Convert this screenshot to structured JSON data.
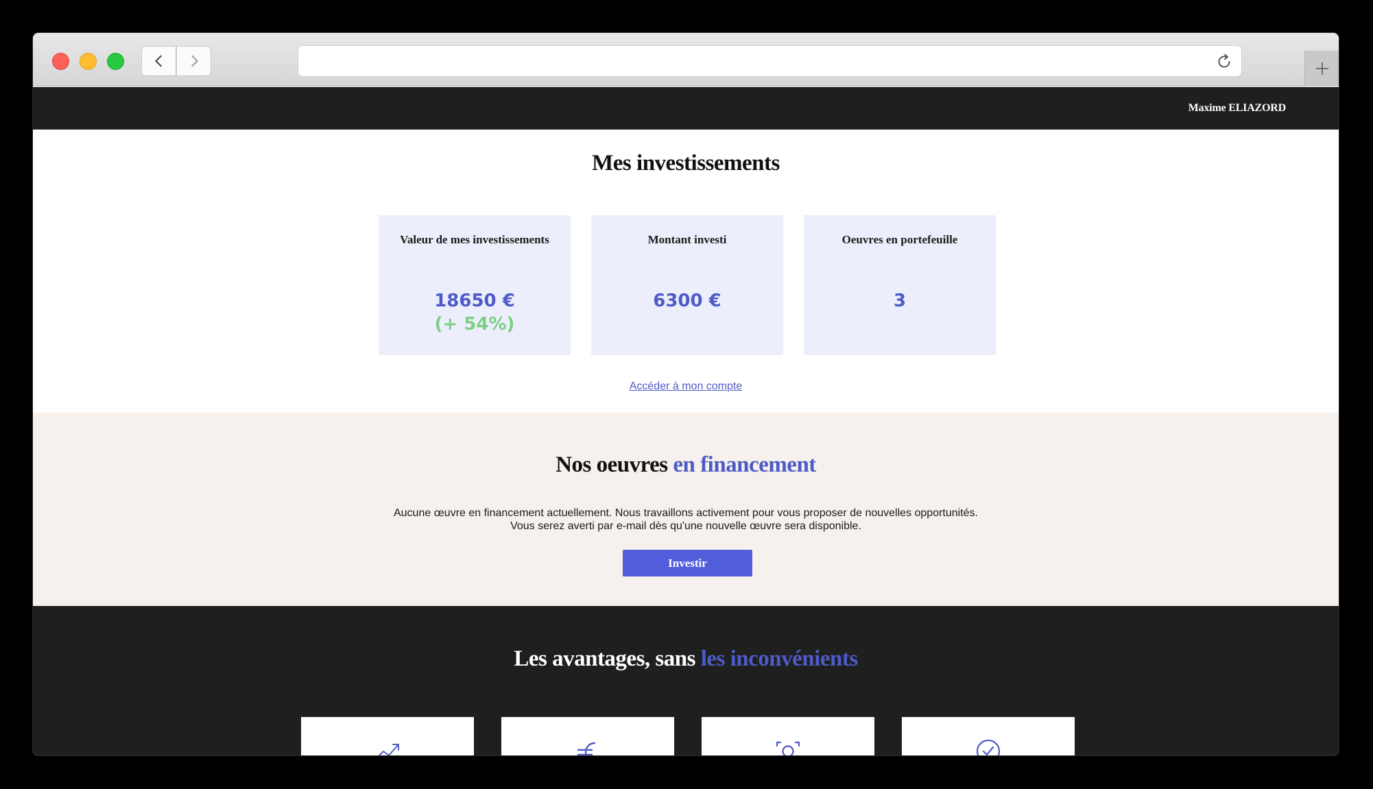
{
  "browser": {
    "url": "",
    "icons": [
      "back-icon",
      "forward-icon",
      "reload-icon",
      "plus-icon"
    ]
  },
  "header": {
    "user_name": "Maxime ELIAZORD"
  },
  "investments": {
    "title": "Mes investissements",
    "cards": [
      {
        "label": "Valeur de mes investissements",
        "value": "18650 €",
        "change": "(+ 54%)"
      },
      {
        "label": "Montant investi",
        "value": "6300 €"
      },
      {
        "label": "Oeuvres en portefeuille",
        "value": "3"
      }
    ],
    "account_link": "Accéder à mon compte"
  },
  "funding": {
    "title_main": "Nos oeuvres",
    "title_accent": "en financement",
    "text_line1": "Aucune œuvre en financement actuellement. Nous travaillons activement pour vous proposer de nouvelles opportunités.",
    "text_line2": "Vous serez averti par e-mail dès qu'une nouvelle œuvre sera disponible.",
    "button_label": "Investir"
  },
  "advantages": {
    "title_main": "Les avantages, sans",
    "title_accent": "les inconvénients",
    "icons": [
      "trend-up-icon",
      "euro-icon",
      "camera-icon",
      "check-circle-icon"
    ]
  },
  "colors": {
    "accent": "#525ddc",
    "positive": "#7ccf83",
    "dark": "#1f1f1f",
    "beige": "#f6f1ec",
    "card_bg": "#eceffb"
  }
}
